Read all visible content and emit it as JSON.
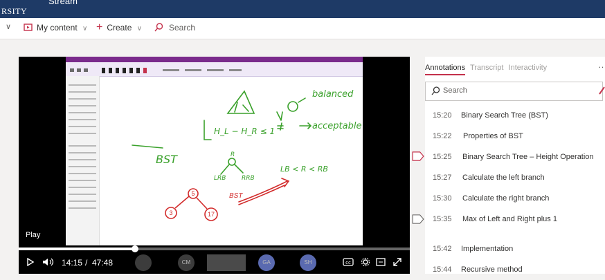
{
  "top_bar": {
    "brand": "RSITY",
    "app": "Stream"
  },
  "nav": {
    "my_content": "My content",
    "create": "Create",
    "search": "Search"
  },
  "player": {
    "play_tooltip": "Play",
    "current_time": "14:15",
    "separator": "/",
    "duration": "47:48",
    "progress": 0.298,
    "attendee_initials": [
      "CM",
      "GA",
      "SH"
    ]
  },
  "whiteboard": {
    "handwriting": [
      "balanced",
      "acceptable",
      "BST",
      "R",
      "LRB",
      "RRB",
      "LB < R < RB",
      "BST"
    ],
    "formula": "H_L − H_R ≤ 1",
    "tree_nodes": [
      "5",
      "3",
      "17"
    ]
  },
  "panel": {
    "tabs": [
      "Annotations",
      "Transcript",
      "Interactivity"
    ],
    "active_tab": "Annotations",
    "search_placeholder": "Search",
    "items": [
      {
        "time": "15:20",
        "label": "Binary Search Tree (BST)"
      },
      {
        "time": "15:22",
        "label": "Properties of BST"
      },
      {
        "time": "15:25",
        "label": "Binary Search Tree – Height Operation"
      },
      {
        "time": "15:27",
        "label": "Calculate the left branch"
      },
      {
        "time": "15:30",
        "label": "Calculate the right branch"
      },
      {
        "time": "15:35",
        "label": "Max of Left and Right  plus 1"
      },
      {
        "time": "15:42",
        "label": "Implementation"
      },
      {
        "time": "15:44",
        "label": "Recursive method"
      }
    ]
  },
  "colors": {
    "accent": "#c4314b",
    "ink": "#3aa12b",
    "tree_red": "#d22b2b",
    "top_bar": "#1e3a66"
  }
}
